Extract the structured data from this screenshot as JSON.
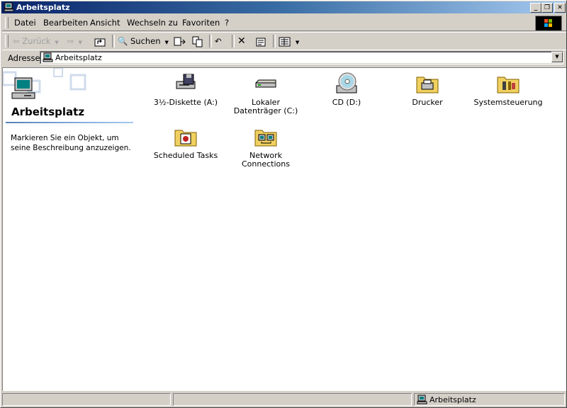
{
  "window": {
    "title": "Arbeitsplatz"
  },
  "title_buttons": {
    "minimize": "_",
    "maximize": "❐",
    "close": "✕"
  },
  "menu": [
    {
      "label": "Datei"
    },
    {
      "label": "Bearbeiten"
    },
    {
      "label": "Ansicht"
    },
    {
      "label": "Wechseln zu"
    },
    {
      "label": "Favoriten"
    },
    {
      "label": "?"
    }
  ],
  "toolbar": {
    "back_label": "Zurück",
    "search_label": "Suchen"
  },
  "address": {
    "label": "Adresse",
    "value": "Arbeitsplatz"
  },
  "sidebar": {
    "title": "Arbeitsplatz",
    "description": "Markieren Sie ein Objekt, um seine Beschreibung anzuzeigen."
  },
  "items": [
    {
      "label": "3½-Diskette (A:)",
      "icon": "floppy-drive-icon"
    },
    {
      "label": "Lokaler Datenträger (C:)",
      "icon": "hard-drive-icon"
    },
    {
      "label": "CD (D:)",
      "icon": "cd-drive-icon"
    },
    {
      "label": "Drucker",
      "icon": "printers-folder-icon"
    },
    {
      "label": "Systemsteuerung",
      "icon": "control-panel-folder-icon"
    },
    {
      "label": "Scheduled Tasks",
      "icon": "scheduled-tasks-folder-icon"
    },
    {
      "label": "Network Connections",
      "icon": "network-connections-folder-icon"
    }
  ],
  "status": {
    "location": "Arbeitsplatz"
  },
  "colors": {
    "title_start": "#0a246a",
    "title_end": "#a6caf0",
    "face": "#d4d0c8"
  }
}
